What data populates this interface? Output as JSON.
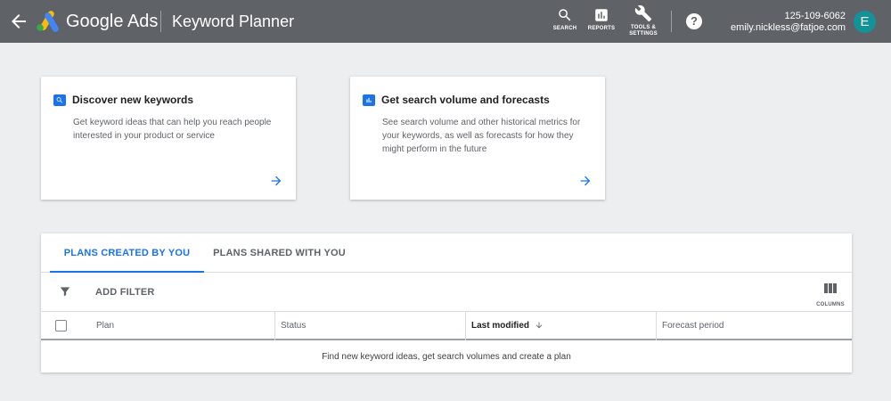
{
  "header": {
    "brand": "Google Ads",
    "product": "Keyword Planner",
    "tools": {
      "search_label": "SEARCH",
      "reports_label": "REPORTS",
      "settings_label_line1": "TOOLS &",
      "settings_label_line2": "SETTINGS"
    },
    "help_glyph": "?",
    "account_id": "125-109-6062",
    "account_email": "emily.nickless@fatjoe.com",
    "avatar_initial": "E",
    "colors": {
      "bar": "#5f6368",
      "avatar": "#12939a"
    }
  },
  "cards": [
    {
      "title": "Discover new keywords",
      "description": "Get keyword ideas that can help you reach people interested in your product or service",
      "icon": "search-icon"
    },
    {
      "title": "Get search volume and forecasts",
      "description": "See search volume and other historical metrics for your keywords, as well as forecasts for how they might perform in the future",
      "icon": "bar-chart-icon"
    }
  ],
  "plans": {
    "tabs": [
      {
        "label": "PLANS CREATED BY YOU",
        "active": true
      },
      {
        "label": "PLANS SHARED WITH YOU",
        "active": false
      }
    ],
    "add_filter_label": "ADD FILTER",
    "columns_label": "COLUMNS",
    "table_headers": {
      "plan": "Plan",
      "status": "Status",
      "last_modified": "Last modified",
      "forecast_period": "Forecast period"
    },
    "empty_message": "Find new keyword ideas, get search volumes and create a plan"
  },
  "accent_color": "#1a73e8"
}
